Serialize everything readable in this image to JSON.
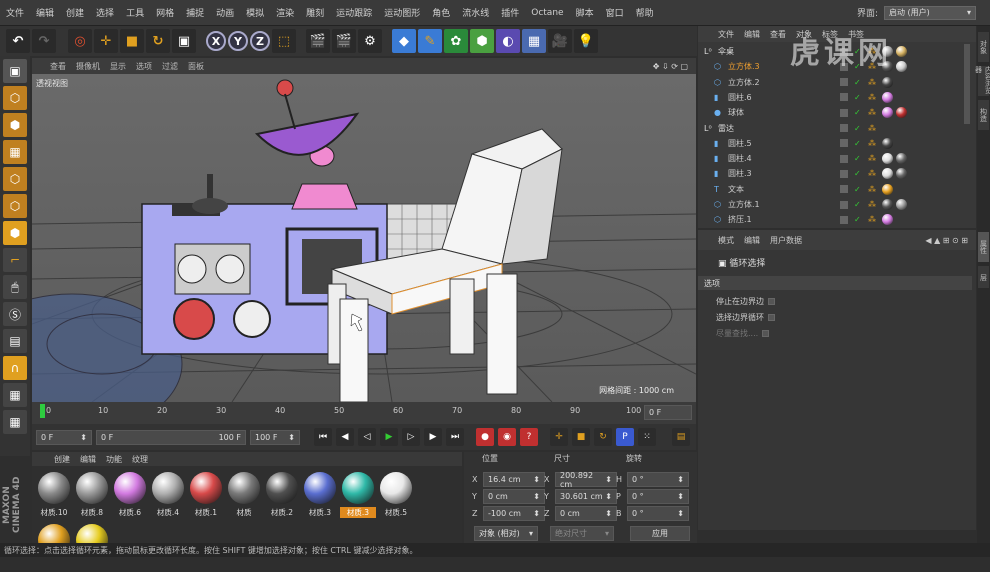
{
  "menu": {
    "items": [
      "文件",
      "编辑",
      "创建",
      "选择",
      "工具",
      "网格",
      "捕捉",
      "动画",
      "模拟",
      "渲染",
      "雕刻",
      "运动跟踪",
      "运动图形",
      "角色",
      "流水线",
      "插件",
      "Octane",
      "脚本",
      "窗口",
      "帮助"
    ],
    "layout_label": "界面:",
    "layout_value": "启动 (用户)"
  },
  "toolbar": {
    "x_label": "X",
    "y_label": "Y",
    "z_label": "Z"
  },
  "viewport": {
    "menu": [
      "查看",
      "摄像机",
      "显示",
      "选项",
      "过滤",
      "面板"
    ],
    "title": "透视视图",
    "grid_spacing": "网格间距 : 1000 cm"
  },
  "timeline": {
    "ticks": [
      "0",
      "10",
      "20",
      "30",
      "40",
      "50",
      "60",
      "70",
      "80",
      "90",
      "100"
    ],
    "frame_field": "0 F"
  },
  "transport": {
    "current_frame": "0 F",
    "range_start": "0 F",
    "range_end": "100 F",
    "end_field": "100 F"
  },
  "materials": {
    "menu": [
      "创建",
      "编辑",
      "功能",
      "纹理"
    ],
    "items": [
      {
        "label": "材质.10",
        "color": "#8a8a8a"
      },
      {
        "label": "材质.8",
        "color": "#9a9a9a"
      },
      {
        "label": "材质.6",
        "color": "#d27ae0"
      },
      {
        "label": "材质.4",
        "color": "#b0b0b0"
      },
      {
        "label": "材质.1",
        "color": "#d84a4a"
      },
      {
        "label": "材质",
        "color": "#7a7a7a"
      },
      {
        "label": "材质.2",
        "color": "#505050"
      },
      {
        "label": "材质.3",
        "color": "#5a6ed0"
      },
      {
        "label": "材质.3",
        "color": "#2fb9a8"
      },
      {
        "label": "材质.5",
        "color": "#e8e8e8"
      },
      {
        "label": "",
        "color": "#e0a020"
      },
      {
        "label": "",
        "color": "#e6cc20"
      }
    ],
    "selected_index": 8
  },
  "coordinates": {
    "headers": [
      "位置",
      "尺寸",
      "旋转"
    ],
    "rows": [
      {
        "axis": "X",
        "pos": "16.4 cm",
        "size_axis": "X",
        "size": "200.892 cm",
        "rot_axis": "H",
        "rot": "0 °"
      },
      {
        "axis": "Y",
        "pos": "0 cm",
        "size_axis": "Y",
        "size": "30.601 cm",
        "rot_axis": "P",
        "rot": "0 °"
      },
      {
        "axis": "Z",
        "pos": "-100 cm",
        "size_axis": "Z",
        "size": "0 cm",
        "rot_axis": "B",
        "rot": "0 °"
      }
    ],
    "mode": "对象 (相对)",
    "size_mode": "绝对尺寸",
    "apply": "应用"
  },
  "objects": {
    "menu": [
      "文件",
      "编辑",
      "查看",
      "对象",
      "标签",
      "书签"
    ],
    "rows": [
      {
        "name": "伞桌",
        "icon": "L0",
        "color": "#ddd",
        "balls": [
          "#aaa",
          "#d4b060"
        ]
      },
      {
        "name": "立方体.3",
        "icon": "cube",
        "color": "#f0a030",
        "balls": [
          "#555",
          "#ccc"
        ]
      },
      {
        "name": "立方体.2",
        "icon": "cube",
        "color": "#ccc",
        "balls": [
          "#444"
        ]
      },
      {
        "name": "圆柱.6",
        "icon": "cyl",
        "color": "#ccc",
        "balls": [
          "#d27ae0"
        ]
      },
      {
        "name": "球体",
        "icon": "sphere",
        "color": "#ccc",
        "balls": [
          "#d27ae0",
          "#c03030"
        ]
      },
      {
        "name": "雷达",
        "icon": "L0",
        "color": "#ddd",
        "balls": []
      },
      {
        "name": "圆柱.5",
        "icon": "cyl",
        "color": "#ccc",
        "balls": [
          "#444"
        ]
      },
      {
        "name": "圆柱.4",
        "icon": "cyl",
        "color": "#ccc",
        "balls": [
          "#ddd",
          "#666"
        ]
      },
      {
        "name": "圆柱.3",
        "icon": "cyl",
        "color": "#ccc",
        "balls": [
          "#ddd",
          "#666"
        ]
      },
      {
        "name": "文本",
        "icon": "text",
        "color": "#ccc",
        "balls": [
          "#e6a020"
        ]
      },
      {
        "name": "立方体.1",
        "icon": "cube",
        "color": "#ccc",
        "balls": [
          "#555",
          "#999"
        ]
      },
      {
        "name": "挤压.1",
        "icon": "cube",
        "color": "#ccc",
        "balls": [
          "#d27ae0"
        ]
      }
    ]
  },
  "attributes": {
    "menu": [
      "模式",
      "编辑",
      "用户数据"
    ],
    "title": "循环选择",
    "section": "选项",
    "options": [
      "停止在边界边",
      "选择边界循环",
      "尽量查找...."
    ]
  },
  "right_tabs": [
    "对象",
    "内容浏览器",
    "构造",
    "属性",
    "层"
  ],
  "status": "循环选择：点击选择循环元素，拖动鼠标更改循环长度。按住 SHIFT 键增加选择对象；按住 CTRL 键减少选择对象。",
  "logo": "MAXON CINEMA 4D",
  "watermark": "虎课网"
}
